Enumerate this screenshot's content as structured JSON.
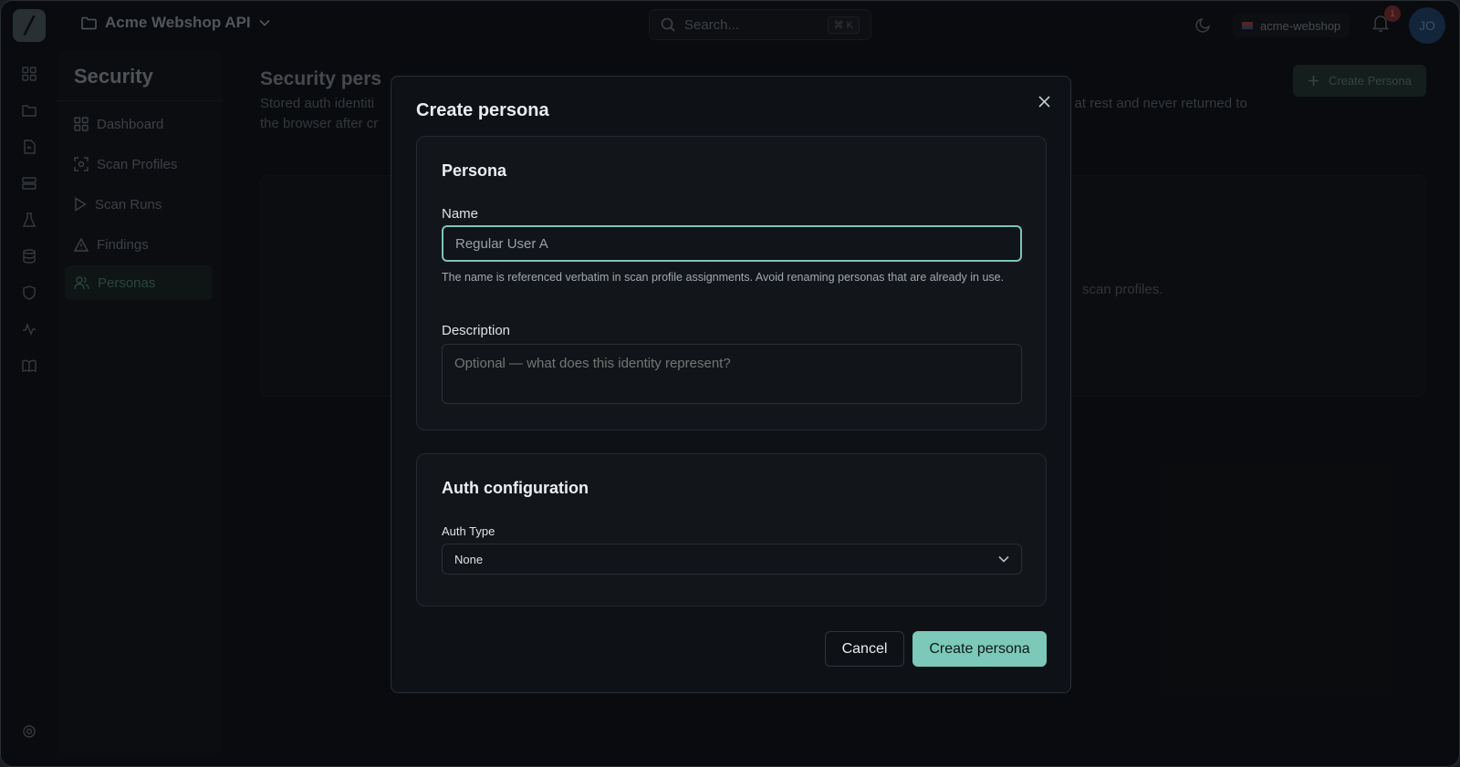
{
  "app": {
    "project_name": "Acme Webshop API",
    "search_placeholder": "Search...",
    "search_shortcut": "⌘ K",
    "org_name": "acme-webshop",
    "notification_count": "1",
    "user_initials": "JO"
  },
  "sidebar": {
    "title": "Security",
    "items": [
      {
        "label": "Dashboard",
        "icon": "dashboard-icon"
      },
      {
        "label": "Scan Profiles",
        "icon": "scan-icon"
      },
      {
        "label": "Scan Runs",
        "icon": "play-icon"
      },
      {
        "label": "Findings",
        "icon": "warning-icon"
      },
      {
        "label": "Personas",
        "icon": "users-icon",
        "active": true
      }
    ]
  },
  "main": {
    "title": "Security pers",
    "subtitle_left": "Stored auth identiti",
    "subtitle_left_line2": "the browser after cr",
    "subtitle_right": "d at rest and never returned to",
    "create_button": "Create Persona",
    "empty_text": "scan profiles."
  },
  "modal": {
    "title": "Create persona",
    "persona_card": {
      "title": "Persona",
      "name_label": "Name",
      "name_value": "Regular User A",
      "name_help": "The name is referenced verbatim in scan profile assignments. Avoid renaming personas that are already in use.",
      "description_label": "Description",
      "description_placeholder": "Optional — what does this identity represent?"
    },
    "auth_card": {
      "title": "Auth configuration",
      "auth_type_label": "Auth Type",
      "auth_type_value": "None"
    },
    "cancel_label": "Cancel",
    "submit_label": "Create persona"
  },
  "colors": {
    "accent": "#7cc8b9",
    "background": "#0e1116"
  }
}
